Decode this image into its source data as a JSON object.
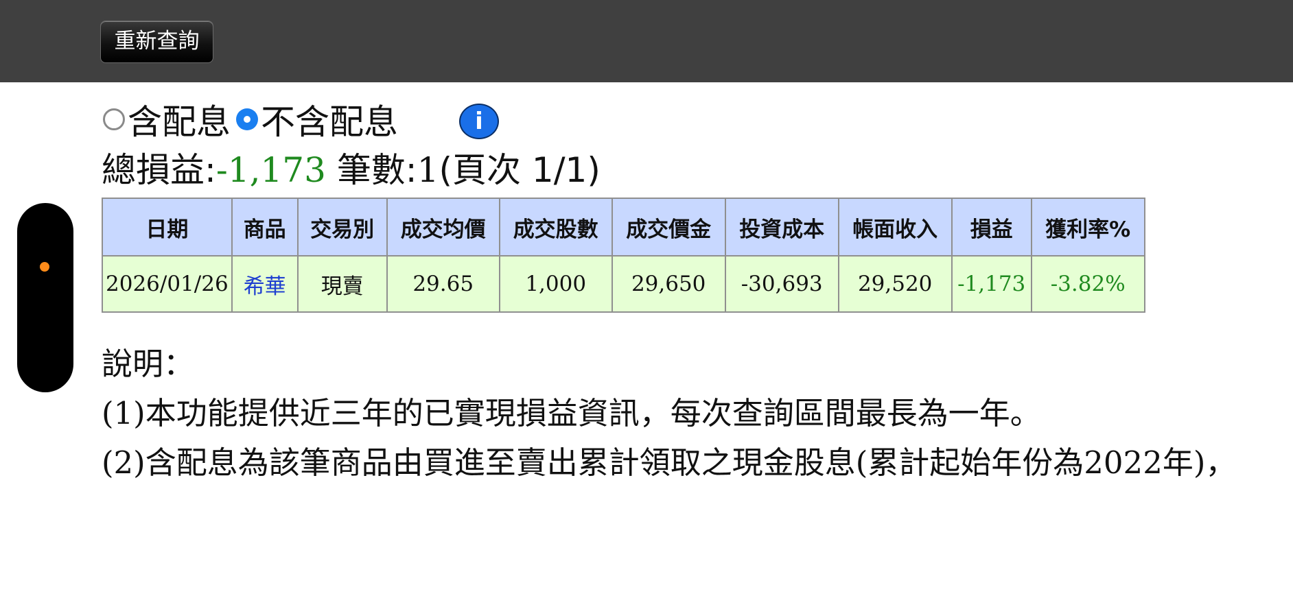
{
  "toolbar": {
    "requery_label": "重新查詢"
  },
  "filter": {
    "options": [
      {
        "label": "含配息",
        "selected": false
      },
      {
        "label": "不含配息",
        "selected": true
      }
    ],
    "info_icon_glyph": "i"
  },
  "summary": {
    "total_label": "總損益:",
    "total_value": "-1,173",
    "count_label": "筆數:",
    "count_value": "1",
    "page_text": "(頁次 1/1)"
  },
  "table": {
    "headers": [
      "日期",
      "商品",
      "交易別",
      "成交均價",
      "成交股數",
      "成交價金",
      "投資成本",
      "帳面收入",
      "損益",
      "獲利率%"
    ],
    "rows": [
      {
        "date": "2026/01/26",
        "product": "希華",
        "trade_type": "現賣",
        "avg_price": "29.65",
        "shares": "1,000",
        "amount": "29,650",
        "cost": "-30,693",
        "income": "29,520",
        "pnl": "-1,173",
        "return_pct": "-3.82%"
      }
    ]
  },
  "notes": {
    "title": "說明：",
    "lines": [
      "(1)本功能提供近三年的已實現損益資訊，每次查詢區間最長為一年。",
      "(2)含配息為該筆商品由買進至賣出累計領取之現金股息(累計起始年份為2022年)，"
    ]
  },
  "colors": {
    "topbar": "#404040",
    "header_bg": "#c8d8ff",
    "row_bg": "#e6ffd4",
    "loss_green": "#1f8a1f",
    "link_blue": "#1e3fd0",
    "radio_selected": "#1a7ff0",
    "handle_dot": "#ff8c1a"
  }
}
